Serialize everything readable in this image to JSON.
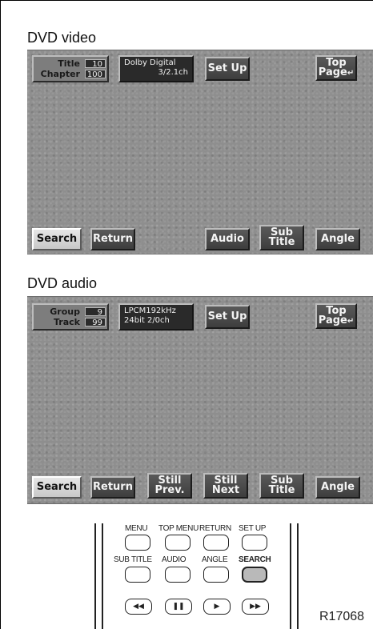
{
  "video": {
    "section_label": "DVD video",
    "info": {
      "row1_label": "Title",
      "row1_value": "10",
      "row2_label": "Chapter",
      "row2_value": "100"
    },
    "format_line1": "Dolby Digital",
    "format_line2": "3/2.1ch",
    "setup_label": "Set Up",
    "top_page_line1": "Top",
    "top_page_line2": "Page",
    "top_page_arrow": "↵",
    "buttons": {
      "search": "Search",
      "return": "Return",
      "audio": "Audio",
      "subtitle_line1": "Sub",
      "subtitle_line2": "Title",
      "angle": "Angle"
    }
  },
  "audio": {
    "section_label": "DVD audio",
    "info": {
      "row1_label": "Group",
      "row1_value": "9",
      "row2_label": "Track",
      "row2_value": "99"
    },
    "format_line1": "LPCM192kHz",
    "format_line2": "24bit 2/0ch",
    "setup_label": "Set Up",
    "top_page_line1": "Top",
    "top_page_line2": "Page",
    "top_page_arrow": "↵",
    "buttons": {
      "search": "Search",
      "return": "Return",
      "still_prev_line1": "Still",
      "still_prev_line2": "Prev.",
      "still_next_line1": "Still",
      "still_next_line2": "Next",
      "subtitle_line1": "Sub",
      "subtitle_line2": "Title",
      "angle": "Angle"
    }
  },
  "remote": {
    "row1_labels": [
      "MENU",
      "TOP MENU",
      "RETURN",
      "SET UP"
    ],
    "row2_labels": [
      "SUB TITLE",
      "AUDIO",
      "ANGLE",
      "SEARCH"
    ],
    "transport_icons": [
      "rewind-icon",
      "pause-icon",
      "play-icon",
      "fast-forward-icon"
    ],
    "transport_glyphs": [
      "◀◀",
      "❚❚",
      "▶",
      "▶▶"
    ],
    "highlighted": "SEARCH"
  },
  "reference_code": "R17068"
}
